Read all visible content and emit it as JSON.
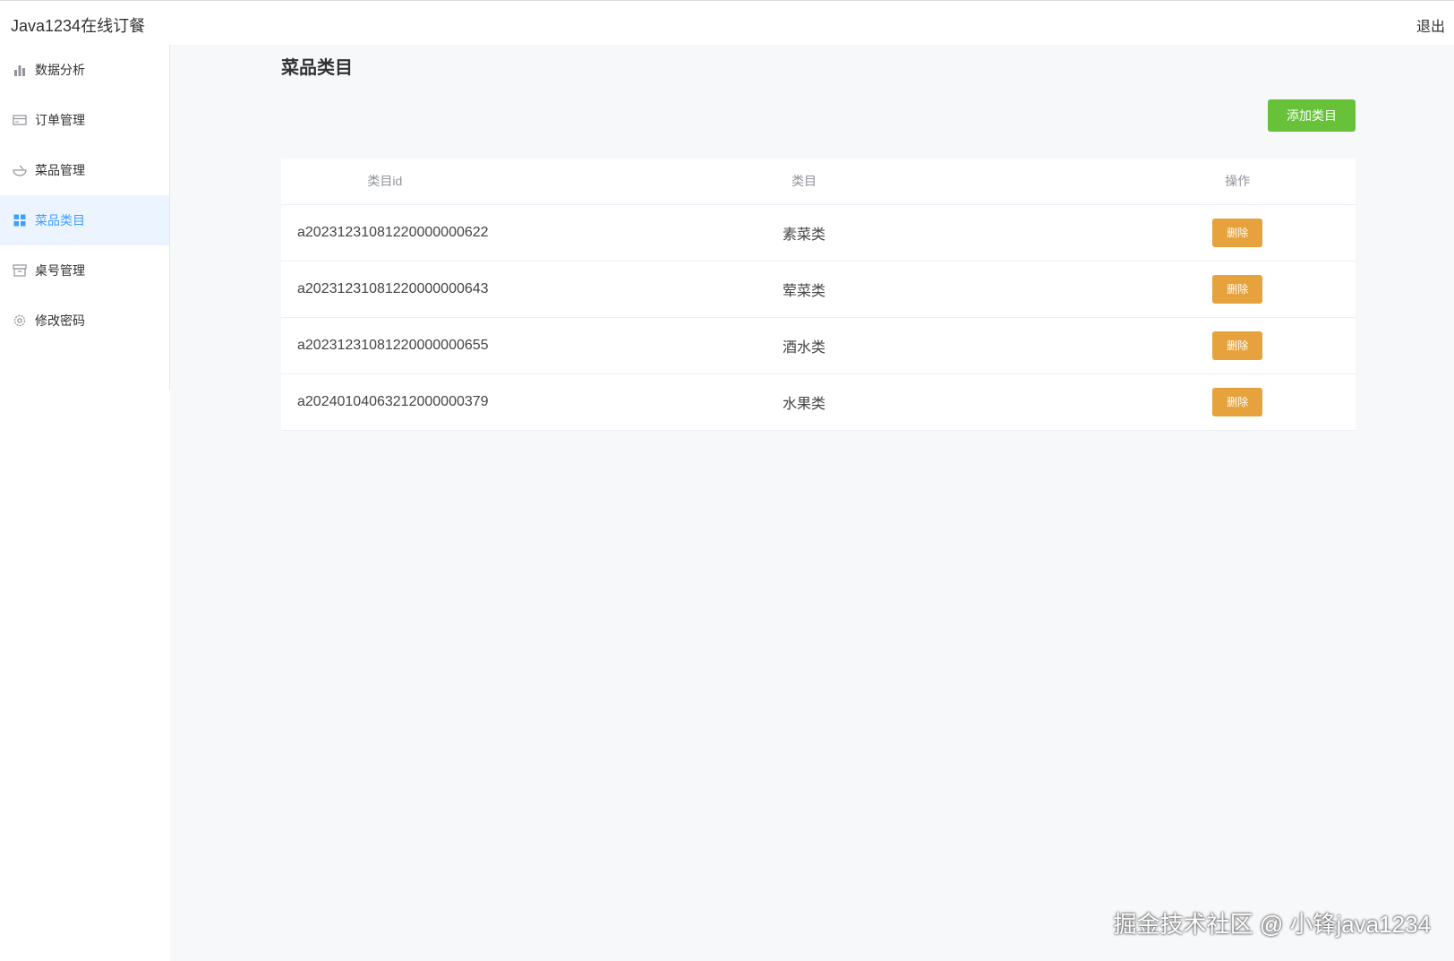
{
  "header": {
    "app_title": "Java1234在线订餐",
    "logout_label": "退出"
  },
  "sidebar": {
    "items": [
      {
        "label": "数据分析",
        "icon": "bar-chart-icon",
        "active": false
      },
      {
        "label": "订单管理",
        "icon": "card-icon",
        "active": false
      },
      {
        "label": "菜品管理",
        "icon": "bowl-icon",
        "active": false
      },
      {
        "label": "菜品类目",
        "icon": "grid-icon",
        "active": true
      },
      {
        "label": "桌号管理",
        "icon": "box-icon",
        "active": false
      },
      {
        "label": "修改密码",
        "icon": "gear-icon",
        "active": false
      }
    ]
  },
  "main": {
    "page_title": "菜品类目",
    "add_button_label": "添加类目",
    "table": {
      "headers": [
        "类目id",
        "类目",
        "操作"
      ],
      "rows": [
        {
          "id": "a20231231081220000000622",
          "name": "素菜类",
          "action": "删除"
        },
        {
          "id": "a20231231081220000000643",
          "name": "荤菜类",
          "action": "删除"
        },
        {
          "id": "a20231231081220000000655",
          "name": "酒水类",
          "action": "删除"
        },
        {
          "id": "a20240104063212000000379",
          "name": "水果类",
          "action": "删除"
        }
      ]
    }
  },
  "watermark": "掘金技术社区 @ 小锋java1234",
  "colors": {
    "accent": "#409eff",
    "add_button": "#67c23a",
    "delete_button": "#e6a23c",
    "background": "#f7f8fa"
  }
}
